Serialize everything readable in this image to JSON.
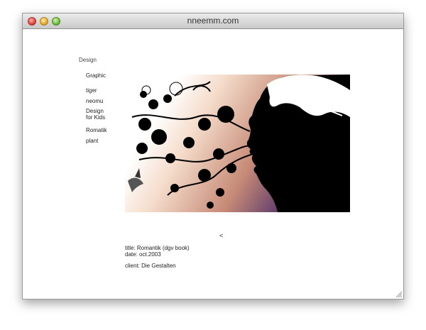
{
  "window": {
    "title": "nneemm.com"
  },
  "nav": {
    "heading": "Design",
    "items": [
      {
        "label": "Graphic"
      },
      {
        "label": "tiger"
      },
      {
        "label": "neomu"
      },
      {
        "label_line1": "Design",
        "label_line2": "for Kids"
      },
      {
        "label": "Romatik"
      },
      {
        "label": "plant"
      }
    ]
  },
  "artwork": {
    "gradient_start": "#f5dccb",
    "gradient_mid": "#c68a76",
    "gradient_end": "#3c2068",
    "ink": "#000000"
  },
  "pager": {
    "prev_label": "<"
  },
  "caption": {
    "title": "title: Romantik (dgv book)",
    "date": "date: oct.2003",
    "client": "client: Die Gestalten"
  }
}
